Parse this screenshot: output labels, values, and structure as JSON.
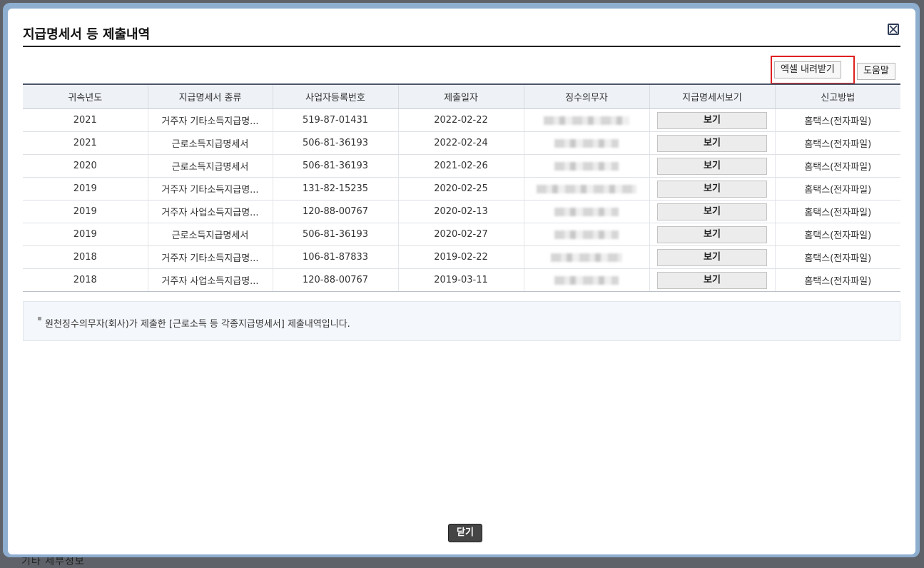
{
  "background": {
    "behind_text": "기타 세부정보"
  },
  "modal": {
    "title": "지급명세서 등 제출내역",
    "excel_button": "엑셀 내려받기",
    "help_button": "도움말",
    "close_button": "닫기",
    "note": "원천징수의무자(회사)가 제출한 [근로소득 등 각종지급명세서] 제출내역입니다."
  },
  "table": {
    "headers": [
      "귀속년도",
      "지급명세서 종류",
      "사업자등록번호",
      "제출일자",
      "징수의무자",
      "지급명세서보기",
      "신고방법"
    ],
    "rows": [
      {
        "year": "2021",
        "type": "거주자 기타소득지급명...",
        "bizno": "519-87-01431",
        "date": "2022-02-22",
        "view": "보기",
        "method": "홈택스(전자파일)"
      },
      {
        "year": "2021",
        "type": "근로소득지급명세서",
        "bizno": "506-81-36193",
        "date": "2022-02-24",
        "view": "보기",
        "method": "홈택스(전자파일)"
      },
      {
        "year": "2020",
        "type": "근로소득지급명세서",
        "bizno": "506-81-36193",
        "date": "2021-02-26",
        "view": "보기",
        "method": "홈택스(전자파일)"
      },
      {
        "year": "2019",
        "type": "거주자 기타소득지급명...",
        "bizno": "131-82-15235",
        "date": "2020-02-25",
        "view": "보기",
        "method": "홈택스(전자파일)"
      },
      {
        "year": "2019",
        "type": "거주자 사업소득지급명...",
        "bizno": "120-88-00767",
        "date": "2020-02-13",
        "view": "보기",
        "method": "홈택스(전자파일)"
      },
      {
        "year": "2019",
        "type": "근로소득지급명세서",
        "bizno": "506-81-36193",
        "date": "2020-02-27",
        "view": "보기",
        "method": "홈택스(전자파일)"
      },
      {
        "year": "2018",
        "type": "거주자 기타소득지급명...",
        "bizno": "106-81-87833",
        "date": "2019-02-22",
        "view": "보기",
        "method": "홈택스(전자파일)"
      },
      {
        "year": "2018",
        "type": "거주자 사업소득지급명...",
        "bizno": "120-88-00767",
        "date": "2019-03-11",
        "view": "보기",
        "method": "홈택스(전자파일)"
      }
    ]
  },
  "colors": {
    "highlight": "#e02020",
    "header_bg": "#eef1f6",
    "close_bg": "#454545",
    "frame": "#8eaed0"
  },
  "icons": {
    "close": "close-x-icon"
  }
}
